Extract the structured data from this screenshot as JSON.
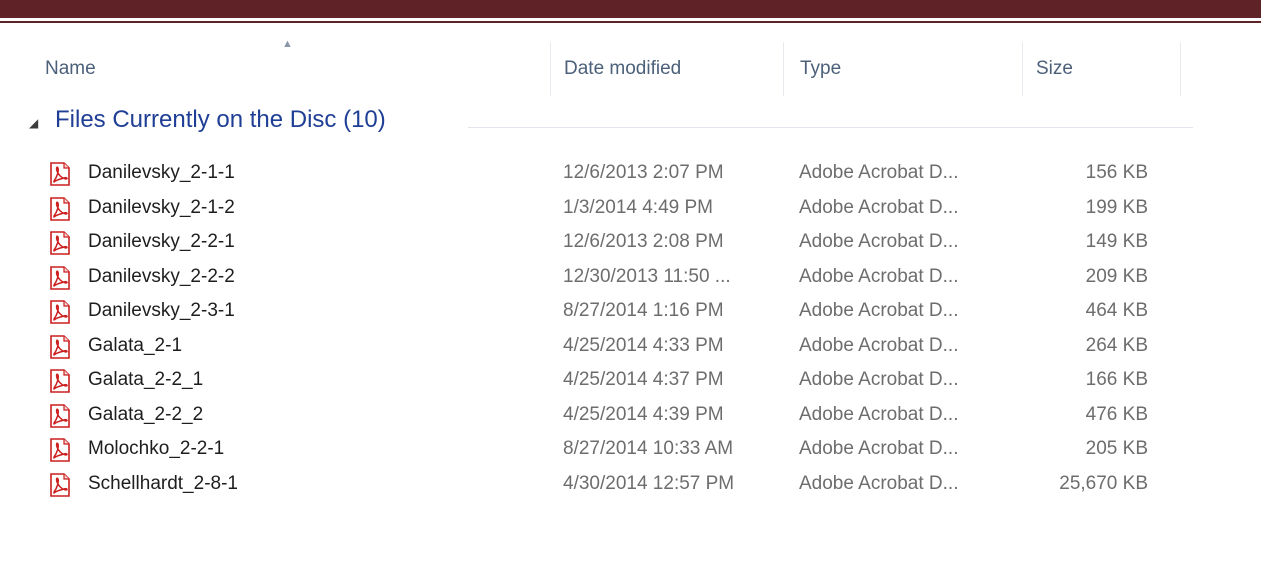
{
  "columns": {
    "name": "Name",
    "date_modified": "Date modified",
    "type": "Type",
    "size": "Size"
  },
  "group": {
    "title": "Files Currently on the Disc (10)"
  },
  "files": [
    {
      "name": "Danilevsky_2-1-1",
      "date": "12/6/2013 2:07 PM",
      "type": "Adobe Acrobat D...",
      "size": "156 KB"
    },
    {
      "name": "Danilevsky_2-1-2",
      "date": "1/3/2014 4:49 PM",
      "type": "Adobe Acrobat D...",
      "size": "199 KB"
    },
    {
      "name": "Danilevsky_2-2-1",
      "date": "12/6/2013 2:08 PM",
      "type": "Adobe Acrobat D...",
      "size": "149 KB"
    },
    {
      "name": "Danilevsky_2-2-2",
      "date": "12/30/2013 11:50 ...",
      "type": "Adobe Acrobat D...",
      "size": "209 KB"
    },
    {
      "name": "Danilevsky_2-3-1",
      "date": "8/27/2014 1:16 PM",
      "type": "Adobe Acrobat D...",
      "size": "464 KB"
    },
    {
      "name": "Galata_2-1",
      "date": "4/25/2014 4:33 PM",
      "type": "Adobe Acrobat D...",
      "size": "264 KB"
    },
    {
      "name": "Galata_2-2_1",
      "date": "4/25/2014 4:37 PM",
      "type": "Adobe Acrobat D...",
      "size": "166 KB"
    },
    {
      "name": "Galata_2-2_2",
      "date": "4/25/2014 4:39 PM",
      "type": "Adobe Acrobat D...",
      "size": "476 KB"
    },
    {
      "name": "Molochko_2-2-1",
      "date": "8/27/2014 10:33 AM",
      "type": "Adobe Acrobat D...",
      "size": "205 KB"
    },
    {
      "name": "Schellhardt_2-8-1",
      "date": "4/30/2014 12:57 PM",
      "type": "Adobe Acrobat D...",
      "size": "25,670 KB"
    }
  ],
  "icons": {
    "file": "pdf-file-icon",
    "group_toggle": "collapse-triangle-icon",
    "sort": "sort-ascending-icon"
  },
  "colors": {
    "top_rule": "#5f2226",
    "group_title": "#1f3f96",
    "header_text": "#4c607a",
    "pdf_red": "#cc1f1f"
  }
}
